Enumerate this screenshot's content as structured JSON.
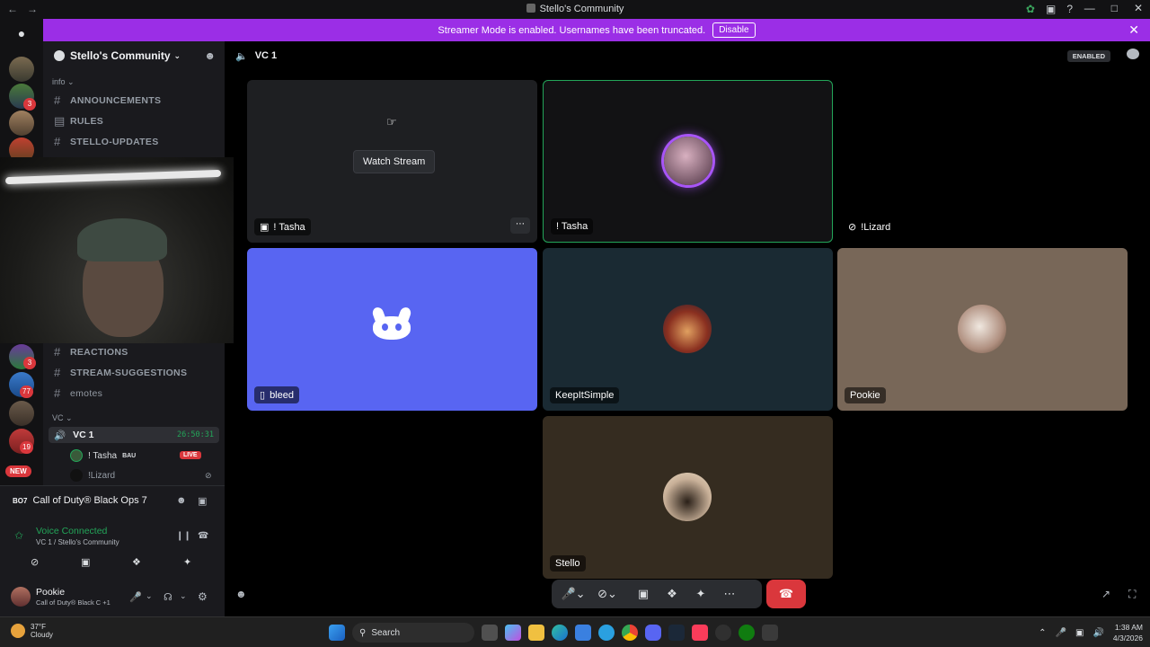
{
  "window": {
    "title": "Stello's Community"
  },
  "banner": {
    "text": "Streamer Mode is enabled. Usernames have been truncated.",
    "button": "Disable"
  },
  "rail": {
    "badges": [
      "3",
      "3",
      "77",
      "19"
    ],
    "new_label": "NEW"
  },
  "guild": {
    "name": "Stello's Community"
  },
  "categories": {
    "info": "info",
    "vc": "VC"
  },
  "channels": [
    {
      "name": "ANNOUNCEMENTS"
    },
    {
      "name": "RULES"
    },
    {
      "name": "STELLO-UPDATES"
    },
    {
      "name": "REACTIONS"
    },
    {
      "name": "STREAM-SUGGESTIONS"
    },
    {
      "name": "emotes"
    }
  ],
  "voice_channel": {
    "name": "VC 1",
    "timer": "26:50:31",
    "users": [
      {
        "name": "! Tasha",
        "tag": "BAU",
        "live": "LIVE"
      },
      {
        "name": "!Lizard"
      }
    ]
  },
  "activity": {
    "game": "Call of Duty® Black Ops 7"
  },
  "voice_status": {
    "status": "Voice Connected",
    "location": "VC 1 / Stello's Community"
  },
  "user": {
    "name": "Pookie",
    "status": "Call of Duty® Black C +1"
  },
  "topbar": {
    "vc_name": "VC 1",
    "enabled_label": "ENABLED"
  },
  "tiles": {
    "tasha_stream": {
      "name": "! Tasha",
      "watch_label": "Watch Stream"
    },
    "tasha_cam": {
      "name": "! Tasha"
    },
    "lizard": {
      "name": "!Lizard"
    },
    "bleed": {
      "name": "bleed"
    },
    "keepitsimple": {
      "name": "KeepItSimple"
    },
    "pookie": {
      "name": "Pookie"
    },
    "stello": {
      "name": "Stello"
    }
  },
  "taskbar": {
    "weather_temp": "37°F",
    "weather_desc": "Cloudy",
    "search_placeholder": "Search",
    "time": "1:38 AM",
    "date": "4/3/2026"
  },
  "colors": {
    "accent": "#9b2ee6",
    "blurple": "#5865f2",
    "danger": "#da373c",
    "online": "#23a559"
  }
}
